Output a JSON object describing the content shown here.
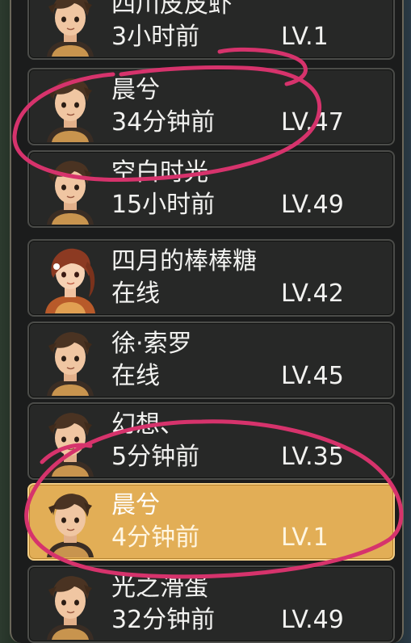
{
  "friends": [
    {
      "name": "四川皮皮虾",
      "status": "3小时前",
      "level": "LV.1",
      "avatar": "male-avatar",
      "selected": false
    },
    {
      "name": "晨兮",
      "status": "34分钟前",
      "level": "LV.47",
      "avatar": "male-avatar",
      "selected": false
    },
    {
      "name": "空白时光",
      "status": "15小时前",
      "level": "LV.49",
      "avatar": "male-avatar",
      "selected": false
    },
    {
      "name": "四月的棒棒糖",
      "status": "在线",
      "level": "LV.42",
      "avatar": "female-avatar",
      "selected": false
    },
    {
      "name": "徐·索罗",
      "status": "在线",
      "level": "LV.45",
      "avatar": "male-avatar",
      "selected": false
    },
    {
      "name": "幻想、",
      "status": "5分钟前",
      "level": "LV.35",
      "avatar": "male-avatar",
      "selected": false
    },
    {
      "name": "晨兮",
      "status": "4分钟前",
      "level": "LV.1",
      "avatar": "male-avatar",
      "selected": true
    },
    {
      "name": "光之滑蛋",
      "status": "32分钟前",
      "level": "LV.49",
      "avatar": "male-avatar",
      "selected": false
    }
  ],
  "colors": {
    "selected_row": "#e2ae56",
    "row": "#272827",
    "annotation_ink": "#d6336c"
  },
  "icons": {
    "male_avatar": "male-avatar-icon",
    "female_avatar": "female-avatar-icon"
  }
}
